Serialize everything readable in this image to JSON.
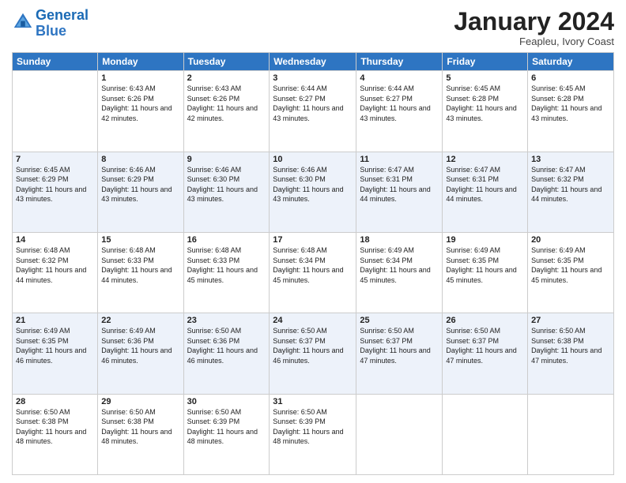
{
  "logo": {
    "line1": "General",
    "line2": "Blue"
  },
  "title": "January 2024",
  "subtitle": "Feapleu, Ivory Coast",
  "weekdays": [
    "Sunday",
    "Monday",
    "Tuesday",
    "Wednesday",
    "Thursday",
    "Friday",
    "Saturday"
  ],
  "weeks": [
    [
      {
        "day": "",
        "sunrise": "",
        "sunset": "",
        "daylight": ""
      },
      {
        "day": "1",
        "sunrise": "Sunrise: 6:43 AM",
        "sunset": "Sunset: 6:26 PM",
        "daylight": "Daylight: 11 hours and 42 minutes."
      },
      {
        "day": "2",
        "sunrise": "Sunrise: 6:43 AM",
        "sunset": "Sunset: 6:26 PM",
        "daylight": "Daylight: 11 hours and 42 minutes."
      },
      {
        "day": "3",
        "sunrise": "Sunrise: 6:44 AM",
        "sunset": "Sunset: 6:27 PM",
        "daylight": "Daylight: 11 hours and 43 minutes."
      },
      {
        "day": "4",
        "sunrise": "Sunrise: 6:44 AM",
        "sunset": "Sunset: 6:27 PM",
        "daylight": "Daylight: 11 hours and 43 minutes."
      },
      {
        "day": "5",
        "sunrise": "Sunrise: 6:45 AM",
        "sunset": "Sunset: 6:28 PM",
        "daylight": "Daylight: 11 hours and 43 minutes."
      },
      {
        "day": "6",
        "sunrise": "Sunrise: 6:45 AM",
        "sunset": "Sunset: 6:28 PM",
        "daylight": "Daylight: 11 hours and 43 minutes."
      }
    ],
    [
      {
        "day": "7",
        "sunrise": "Sunrise: 6:45 AM",
        "sunset": "Sunset: 6:29 PM",
        "daylight": "Daylight: 11 hours and 43 minutes."
      },
      {
        "day": "8",
        "sunrise": "Sunrise: 6:46 AM",
        "sunset": "Sunset: 6:29 PM",
        "daylight": "Daylight: 11 hours and 43 minutes."
      },
      {
        "day": "9",
        "sunrise": "Sunrise: 6:46 AM",
        "sunset": "Sunset: 6:30 PM",
        "daylight": "Daylight: 11 hours and 43 minutes."
      },
      {
        "day": "10",
        "sunrise": "Sunrise: 6:46 AM",
        "sunset": "Sunset: 6:30 PM",
        "daylight": "Daylight: 11 hours and 43 minutes."
      },
      {
        "day": "11",
        "sunrise": "Sunrise: 6:47 AM",
        "sunset": "Sunset: 6:31 PM",
        "daylight": "Daylight: 11 hours and 44 minutes."
      },
      {
        "day": "12",
        "sunrise": "Sunrise: 6:47 AM",
        "sunset": "Sunset: 6:31 PM",
        "daylight": "Daylight: 11 hours and 44 minutes."
      },
      {
        "day": "13",
        "sunrise": "Sunrise: 6:47 AM",
        "sunset": "Sunset: 6:32 PM",
        "daylight": "Daylight: 11 hours and 44 minutes."
      }
    ],
    [
      {
        "day": "14",
        "sunrise": "Sunrise: 6:48 AM",
        "sunset": "Sunset: 6:32 PM",
        "daylight": "Daylight: 11 hours and 44 minutes."
      },
      {
        "day": "15",
        "sunrise": "Sunrise: 6:48 AM",
        "sunset": "Sunset: 6:33 PM",
        "daylight": "Daylight: 11 hours and 44 minutes."
      },
      {
        "day": "16",
        "sunrise": "Sunrise: 6:48 AM",
        "sunset": "Sunset: 6:33 PM",
        "daylight": "Daylight: 11 hours and 45 minutes."
      },
      {
        "day": "17",
        "sunrise": "Sunrise: 6:48 AM",
        "sunset": "Sunset: 6:34 PM",
        "daylight": "Daylight: 11 hours and 45 minutes."
      },
      {
        "day": "18",
        "sunrise": "Sunrise: 6:49 AM",
        "sunset": "Sunset: 6:34 PM",
        "daylight": "Daylight: 11 hours and 45 minutes."
      },
      {
        "day": "19",
        "sunrise": "Sunrise: 6:49 AM",
        "sunset": "Sunset: 6:35 PM",
        "daylight": "Daylight: 11 hours and 45 minutes."
      },
      {
        "day": "20",
        "sunrise": "Sunrise: 6:49 AM",
        "sunset": "Sunset: 6:35 PM",
        "daylight": "Daylight: 11 hours and 45 minutes."
      }
    ],
    [
      {
        "day": "21",
        "sunrise": "Sunrise: 6:49 AM",
        "sunset": "Sunset: 6:35 PM",
        "daylight": "Daylight: 11 hours and 46 minutes."
      },
      {
        "day": "22",
        "sunrise": "Sunrise: 6:49 AM",
        "sunset": "Sunset: 6:36 PM",
        "daylight": "Daylight: 11 hours and 46 minutes."
      },
      {
        "day": "23",
        "sunrise": "Sunrise: 6:50 AM",
        "sunset": "Sunset: 6:36 PM",
        "daylight": "Daylight: 11 hours and 46 minutes."
      },
      {
        "day": "24",
        "sunrise": "Sunrise: 6:50 AM",
        "sunset": "Sunset: 6:37 PM",
        "daylight": "Daylight: 11 hours and 46 minutes."
      },
      {
        "day": "25",
        "sunrise": "Sunrise: 6:50 AM",
        "sunset": "Sunset: 6:37 PM",
        "daylight": "Daylight: 11 hours and 47 minutes."
      },
      {
        "day": "26",
        "sunrise": "Sunrise: 6:50 AM",
        "sunset": "Sunset: 6:37 PM",
        "daylight": "Daylight: 11 hours and 47 minutes."
      },
      {
        "day": "27",
        "sunrise": "Sunrise: 6:50 AM",
        "sunset": "Sunset: 6:38 PM",
        "daylight": "Daylight: 11 hours and 47 minutes."
      }
    ],
    [
      {
        "day": "28",
        "sunrise": "Sunrise: 6:50 AM",
        "sunset": "Sunset: 6:38 PM",
        "daylight": "Daylight: 11 hours and 48 minutes."
      },
      {
        "day": "29",
        "sunrise": "Sunrise: 6:50 AM",
        "sunset": "Sunset: 6:38 PM",
        "daylight": "Daylight: 11 hours and 48 minutes."
      },
      {
        "day": "30",
        "sunrise": "Sunrise: 6:50 AM",
        "sunset": "Sunset: 6:39 PM",
        "daylight": "Daylight: 11 hours and 48 minutes."
      },
      {
        "day": "31",
        "sunrise": "Sunrise: 6:50 AM",
        "sunset": "Sunset: 6:39 PM",
        "daylight": "Daylight: 11 hours and 48 minutes."
      },
      {
        "day": "",
        "sunrise": "",
        "sunset": "",
        "daylight": ""
      },
      {
        "day": "",
        "sunrise": "",
        "sunset": "",
        "daylight": ""
      },
      {
        "day": "",
        "sunrise": "",
        "sunset": "",
        "daylight": ""
      }
    ]
  ]
}
